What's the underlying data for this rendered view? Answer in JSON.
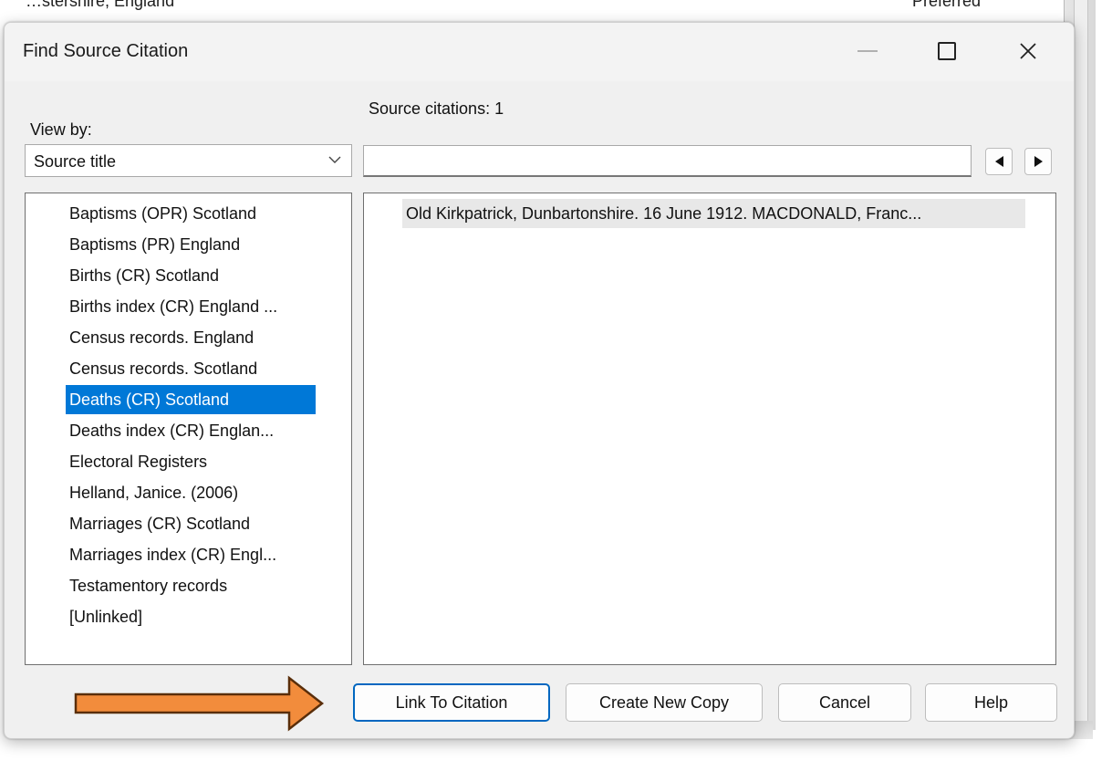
{
  "background_window": {
    "row_text_left": "…stershire, England",
    "row_text_right": "Preferred"
  },
  "dialog": {
    "title": "Find Source Citation",
    "controls": {
      "minimize_icon": "minimize-icon",
      "maximize_icon": "maximize-icon",
      "close_icon": "close-icon"
    }
  },
  "view_by": {
    "label": "View by:",
    "selected": "Source title",
    "dropdown_icon": "chevron-down-icon"
  },
  "citations": {
    "count_label": "Source citations: 1",
    "search_value": "",
    "prev_icon": "triangle-left-icon",
    "next_icon": "triangle-right-icon",
    "items": [
      "Old Kirkpatrick, Dunbartonshire. 16 June 1912. MACDONALD, Franc..."
    ]
  },
  "sources": {
    "selected_index": 6,
    "items": [
      "Baptisms (OPR) Scotland",
      "Baptisms (PR) England",
      "Births (CR) Scotland",
      "Births index (CR) England ...",
      "Census records. England",
      "Census records. Scotland",
      "Deaths (CR) Scotland",
      "Deaths index (CR) Englan...",
      "Electoral Registers",
      "Helland, Janice. (2006)",
      "Marriages (CR) Scotland",
      "Marriages index (CR) Engl...",
      "Testamentory records",
      "[Unlinked]"
    ]
  },
  "buttons": {
    "link": "Link To Citation",
    "create": "Create New Copy",
    "cancel": "Cancel",
    "help": "Help"
  },
  "annotation": {
    "arrow_color": "#f28c3c",
    "arrow_border": "#5a2e0a"
  },
  "colors": {
    "selection": "#0078d7",
    "default_button_border": "#0067c0",
    "dialog_bg": "#f0f0f0"
  }
}
